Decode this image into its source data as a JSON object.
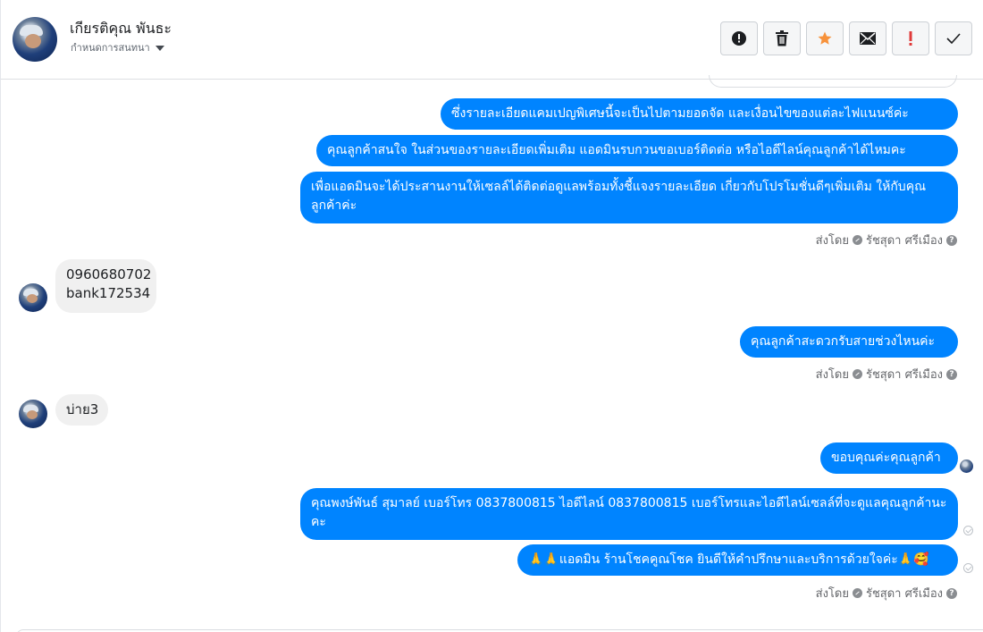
{
  "contact": {
    "name": "เกียรติคุณ พันธะ",
    "subtitle": "กำหนดการสนทนา"
  },
  "toolbar": {
    "buttons": [
      {
        "name": "spam-button",
        "icon": "alert-circle-icon"
      },
      {
        "name": "delete-button",
        "icon": "trash-icon"
      },
      {
        "name": "star-button",
        "icon": "star-icon",
        "color": "#f7923b"
      },
      {
        "name": "mail-button",
        "icon": "envelope-icon"
      },
      {
        "name": "important-button",
        "icon": "exclamation-icon",
        "color": "#e03a3a"
      },
      {
        "name": "done-button",
        "icon": "check-icon"
      }
    ]
  },
  "messages": {
    "m1": "ซึ่งรายละเอียดแคมเปญพิเศษนี้จะเป็นไปตามยอดจัด และเงื่อนไขของแต่ละไฟแนนซ์ค่ะ",
    "m2": "คุณลูกค้าสนใจ ในส่วนของรายละเอียดเพิ่มเติม แอดมินรบกวนขอเบอร์ติดต่อ หรือไอดีไลน์คุณลูกค้าได้ไหมคะ",
    "m3": "เพื่อแอดมินจะได้ประสานงานให้เซลล์ได้ติดต่อดูแลพร้อมทั้งชี้แจงรายละเอียด เกี่ยวกับโปรโมชั่นดีๆเพิ่มเติม ให้กับคุณลูกค้าค่ะ",
    "m4_line1": "0960680702",
    "m4_line2": "bank172534",
    "m5": "คุณลูกค้าสะดวกรับสายช่วงไหนค่ะ",
    "m6": "บ่าย3",
    "m7": "ขอบคุณค่ะคุณลูกค้า",
    "m8": "คุณพงษ์พันธ์ สุมาลย์      เบอร์โทร 0837800815  ไอดีไลน์ 0837800815  เบอร์โทรและไอดีไลน์เซลล์ที่จะดูแลคุณลูกค้านะคะ",
    "m9": "🙏🙏แอดมิน ร้านโชคคูณโชค ยินดีให้คำปรึกษาและบริการด้วยใจค่ะ🙏🥰"
  },
  "sent_by": {
    "prefix": "ส่งโดย",
    "agent": "รัชสุดา ศรีเมือง"
  },
  "colors": {
    "outgoing": "#0084ff",
    "incoming": "#f0f0f0"
  }
}
